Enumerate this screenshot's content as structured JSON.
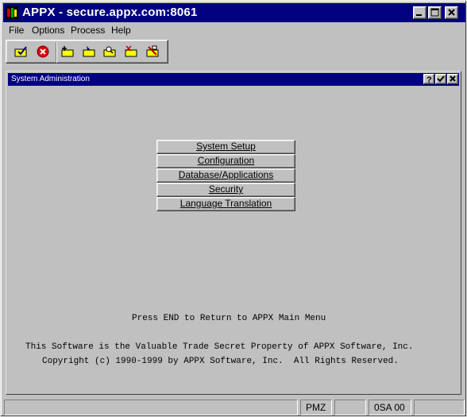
{
  "window": {
    "title": "APPX - secure.appx.com:8061"
  },
  "menu": {
    "items": [
      "File",
      "Options",
      "Process",
      "Help"
    ]
  },
  "toolbar": {
    "icons": [
      "check-folder-icon",
      "cancel-icon",
      "add-folder-icon",
      "change-folder-icon",
      "inquire-folder-icon",
      "delete-folder-icon",
      "end-folder-icon"
    ]
  },
  "child_window": {
    "title": "System Administration",
    "buttons": [
      "help",
      "check",
      "close"
    ]
  },
  "menu_options": [
    "System Setup",
    "Configuration",
    "Database/Applications",
    "Security",
    "Language Translation"
  ],
  "messages": {
    "press_end": "Press END to Return to APPX Main Menu",
    "trade_secret": "This Software is the Valuable Trade Secret Property of APPX Software, Inc.",
    "copyright": "Copyright (c) 1990-1999 by APPX Software, Inc.  All Rights Reserved."
  },
  "statusbar": {
    "panels": [
      "",
      "PMZ",
      "",
      "0SA 00",
      ""
    ]
  }
}
